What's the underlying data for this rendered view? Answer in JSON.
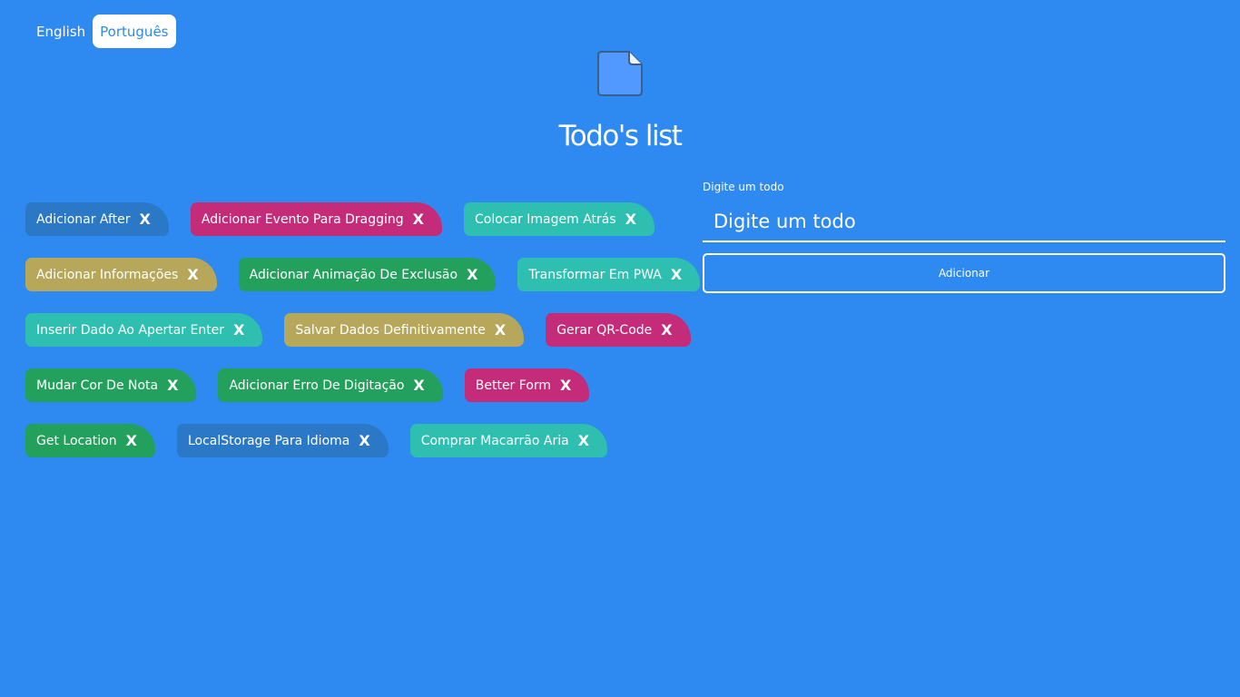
{
  "languages": [
    {
      "label": "English",
      "active": false
    },
    {
      "label": "Português",
      "active": true
    }
  ],
  "logo_icon": "document-icon",
  "title": "Todo's list",
  "form": {
    "label": "Digite um todo",
    "placeholder": "Digite um todo",
    "value": "",
    "add_label": "Adicionar"
  },
  "colors": {
    "background": "#2e89f0",
    "blue": "#2b78c7",
    "pink": "#c42b78",
    "teal": "#2ebfb0",
    "olive": "#b6a75a",
    "green": "#24a05d"
  },
  "todos": [
    [
      {
        "text": "Adicionar After",
        "delete": "X",
        "color": "#2b78c7"
      },
      {
        "text": "Adicionar Evento Para Dragging",
        "delete": "X",
        "color": "#c42b78"
      },
      {
        "text": "Colocar Imagem Atrás",
        "delete": "X",
        "color": "#2ebfb0"
      }
    ],
    [
      {
        "text": "Adicionar Informações",
        "delete": "X",
        "color": "#b6a75a"
      },
      {
        "text": "Adicionar Animação De Exclusão",
        "delete": "X",
        "color": "#24a05d"
      },
      {
        "text": "Transformar Em PWA",
        "delete": "X",
        "color": "#2ebfb0"
      }
    ],
    [
      {
        "text": "Inserir Dado Ao Apertar Enter",
        "delete": "X",
        "color": "#2ebfb0"
      },
      {
        "text": "Salvar Dados Definitivamente",
        "delete": "X",
        "color": "#b6a75a"
      },
      {
        "text": "Gerar QR-Code",
        "delete": "X",
        "color": "#c42b78"
      }
    ],
    [
      {
        "text": "Mudar Cor De Nota",
        "delete": "X",
        "color": "#24a05d"
      },
      {
        "text": "Adicionar Erro De Digitação",
        "delete": "X",
        "color": "#24a05d"
      },
      {
        "text": "Better Form",
        "delete": "X",
        "color": "#c42b78"
      }
    ],
    [
      {
        "text": "Get Location",
        "delete": "X",
        "color": "#24a05d"
      },
      {
        "text": "LocalStorage Para Idioma",
        "delete": "X",
        "color": "#2b78c7"
      },
      {
        "text": "Comprar Macarrão Aria",
        "delete": "X",
        "color": "#2ebfb0"
      }
    ]
  ]
}
